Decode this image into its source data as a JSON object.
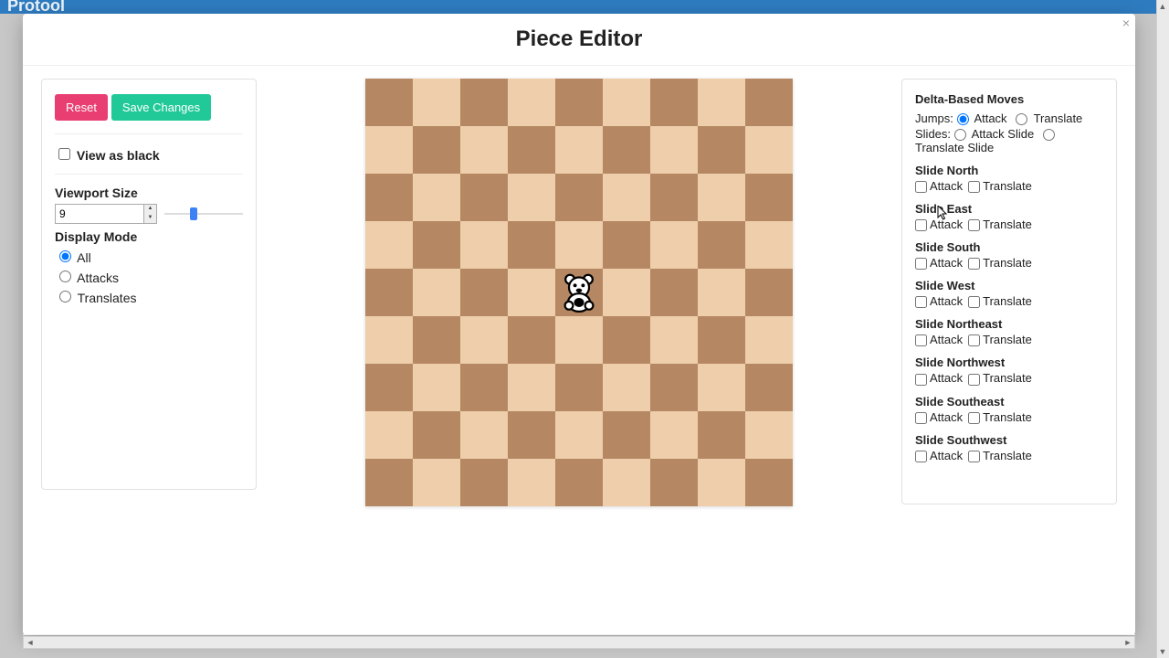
{
  "topbar": {
    "brand": "Protool"
  },
  "modal": {
    "title": "Piece Editor",
    "close": "×"
  },
  "left": {
    "reset": "Reset",
    "save": "Save Changes",
    "view_as_black": "View as black",
    "viewport_label": "Viewport Size",
    "viewport_value": "9",
    "display_mode_label": "Display Mode",
    "display_modes": {
      "all": "All",
      "attacks": "Attacks",
      "translates": "Translates"
    }
  },
  "board": {
    "size": 9,
    "piece_row": 4,
    "piece_col": 4
  },
  "right": {
    "heading": "Delta-Based Moves",
    "jumps_label": "Jumps:",
    "jumps_attack": "Attack",
    "jumps_translate": "Translate",
    "slides_label": "Slides:",
    "slides_attack": "Attack Slide",
    "slides_translate": "Translate Slide",
    "check_attack": "Attack",
    "check_translate": "Translate",
    "slide_groups": [
      "Slide North",
      "Slide East",
      "Slide South",
      "Slide West",
      "Slide Northeast",
      "Slide Northwest",
      "Slide Southeast",
      "Slide Southwest"
    ]
  }
}
